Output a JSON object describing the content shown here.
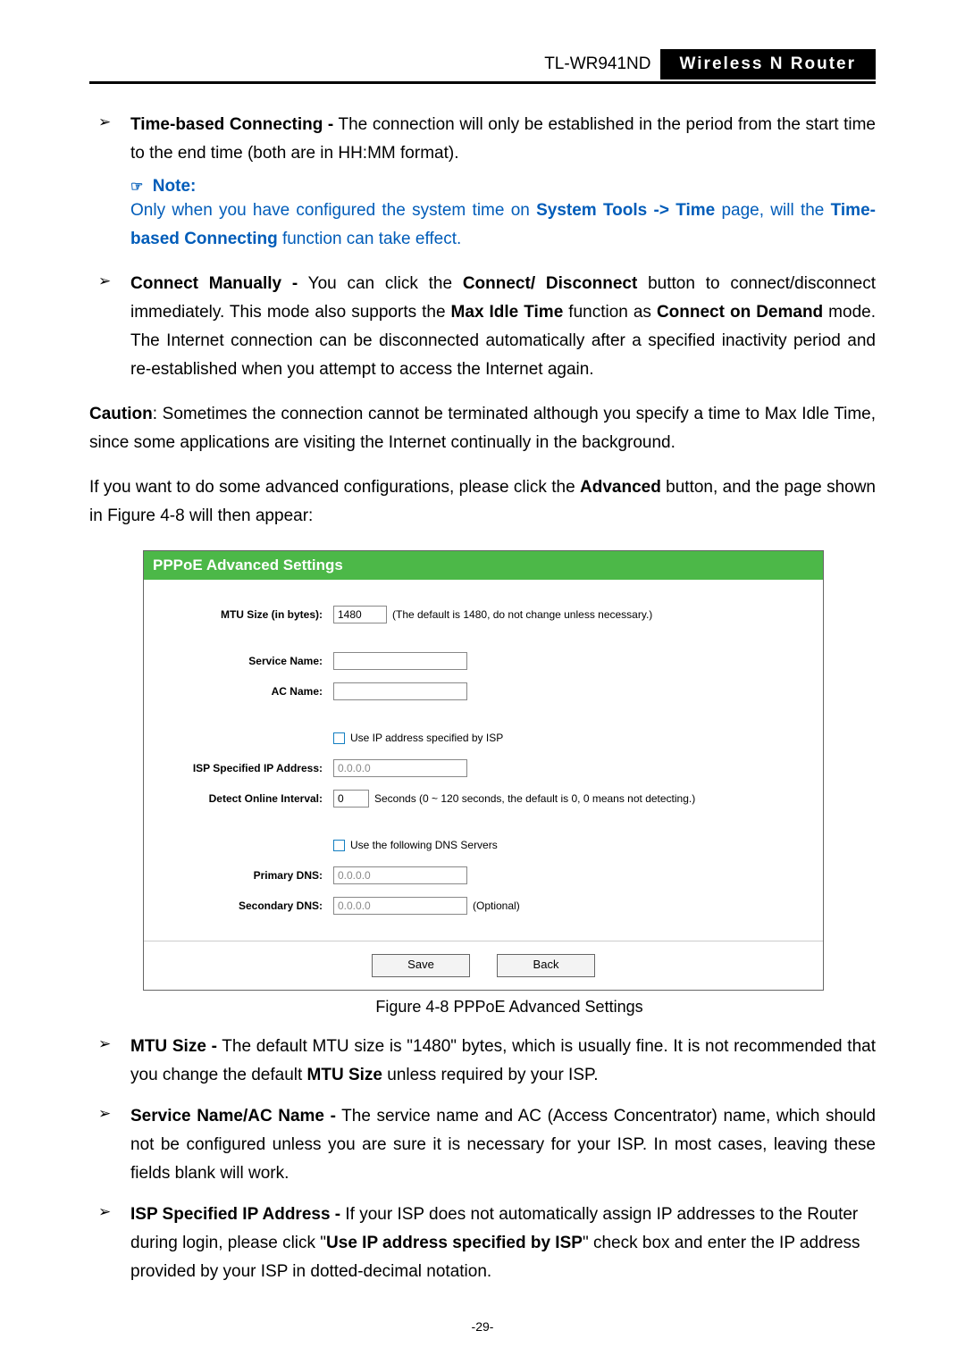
{
  "header": {
    "model": "TL-WR941ND",
    "product": "Wireless  N  Router"
  },
  "bullet1": {
    "lead": "Time-based Connecting -",
    "rest": " The connection will only be established in the period from the start time to the end time (both are in HH:MM format)."
  },
  "note": {
    "icon": "☞",
    "label": "Note:",
    "l1a": "Only when you have configured the system time on ",
    "l1b": "System Tools -> Time",
    "l1c": " page, will the ",
    "l2a": "Time-based Connecting",
    "l2b": " function can take effect."
  },
  "bullet2": {
    "lead": "Connect Manually -",
    "p1": " You can click the ",
    "b1": "Connect/ Disconnect",
    "p2": " button to connect/disconnect immediately. This mode also supports the ",
    "b2": "Max Idle Time",
    "p3": " function as ",
    "b3": "Connect on Demand",
    "p4": " mode. The Internet connection can be disconnected automatically after a specified inactivity period and re-established when you attempt to access the Internet again."
  },
  "caution": {
    "lead": "Caution",
    "rest": ": Sometimes the connection cannot be terminated although you specify a time to Max Idle Time, since some applications are visiting the Internet continually in the background."
  },
  "advIntro": {
    "p1": "If you want to do some advanced configurations, please click the ",
    "b1": "Advanced",
    "p2": " button, and the page shown in Figure 4-8 will then appear:"
  },
  "figure": {
    "title": "PPPoE Advanced Settings",
    "mtu_label": "MTU Size (in bytes):",
    "mtu_value": "1480",
    "mtu_hint": "(The default is 1480, do not change unless necessary.)",
    "service_label": "Service Name:",
    "service_value": "",
    "ac_label": "AC Name:",
    "ac_value": "",
    "use_isp_ip": "Use IP address specified by ISP",
    "isp_ip_label": "ISP Specified IP Address:",
    "isp_ip_value": "0.0.0.0",
    "detect_label": "Detect Online Interval:",
    "detect_value": "0",
    "detect_hint": "Seconds (0 ~ 120 seconds, the default is 0, 0 means not detecting.)",
    "use_dns": "Use the following DNS Servers",
    "pdns_label": "Primary DNS:",
    "pdns_value": "0.0.0.0",
    "sdns_label": "Secondary DNS:",
    "sdns_value": "0.0.0.0",
    "optional": "(Optional)",
    "save": "Save",
    "back": "Back",
    "caption": "Figure 4-8    PPPoE Advanced Settings"
  },
  "bullet3": {
    "lead": "MTU Size -",
    "p1": " The default MTU size is \"1480\" bytes, which is usually fine. It is not recommended that you change the default ",
    "b1": "MTU Size",
    "p2": " unless required by your ISP."
  },
  "bullet4": {
    "lead": "Service Name/AC Name -",
    "rest": " The service name and AC (Access Concentrator) name, which should not be configured unless you are sure it is necessary for your ISP. In most cases, leaving these fields blank will work."
  },
  "bullet5": {
    "lead": "ISP Specified IP Address -",
    "p1": " If your ISP does not automatically assign IP addresses to the Router during login, please click \"",
    "b1": "Use IP address specified by ISP",
    "p2": "\" check box and enter the IP address provided by your ISP in dotted-decimal notation."
  },
  "pagenum": "-29-"
}
